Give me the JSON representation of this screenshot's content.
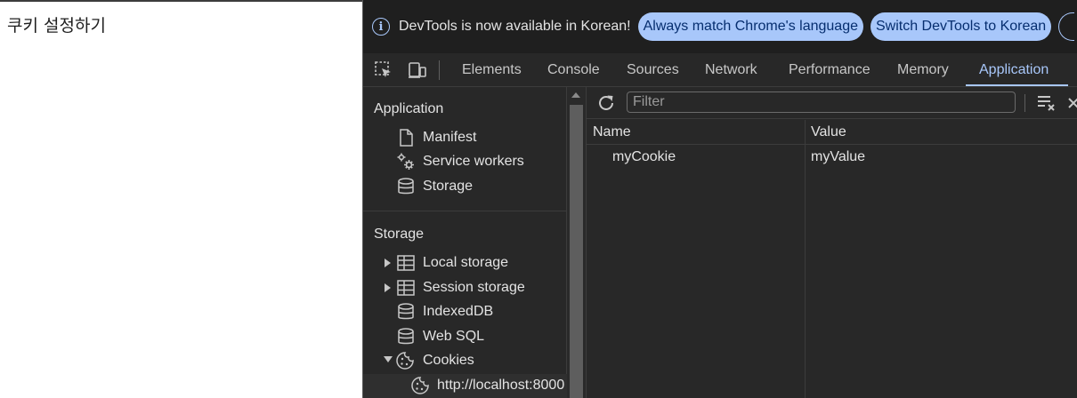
{
  "page": {
    "text": "쿠키 설정하기"
  },
  "infobar": {
    "message": "DevTools is now available in Korean!",
    "match_language_button": "Always match Chrome's language",
    "switch_button": "Switch DevTools to Korean"
  },
  "tabs": [
    "Elements",
    "Console",
    "Sources",
    "Network",
    "Performance",
    "Memory",
    "Application"
  ],
  "active_tab": "Application",
  "sidebar": {
    "application_title": "Application",
    "application_items": [
      "Manifest",
      "Service workers",
      "Storage"
    ],
    "storage_title": "Storage",
    "storage_items": [
      "Local storage",
      "Session storage",
      "IndexedDB",
      "Web SQL",
      "Cookies"
    ],
    "cookie_origin": "http://localhost:8000"
  },
  "main": {
    "filter_placeholder": "Filter",
    "columns": [
      "Name",
      "Value"
    ],
    "rows": [
      {
        "name": "myCookie",
        "value": "myValue"
      }
    ]
  },
  "colors": {
    "accent": "#a8c7fa",
    "panel_bg": "#282828",
    "infobar_bg": "#1f1f1f",
    "text": "#e3e3e3"
  }
}
